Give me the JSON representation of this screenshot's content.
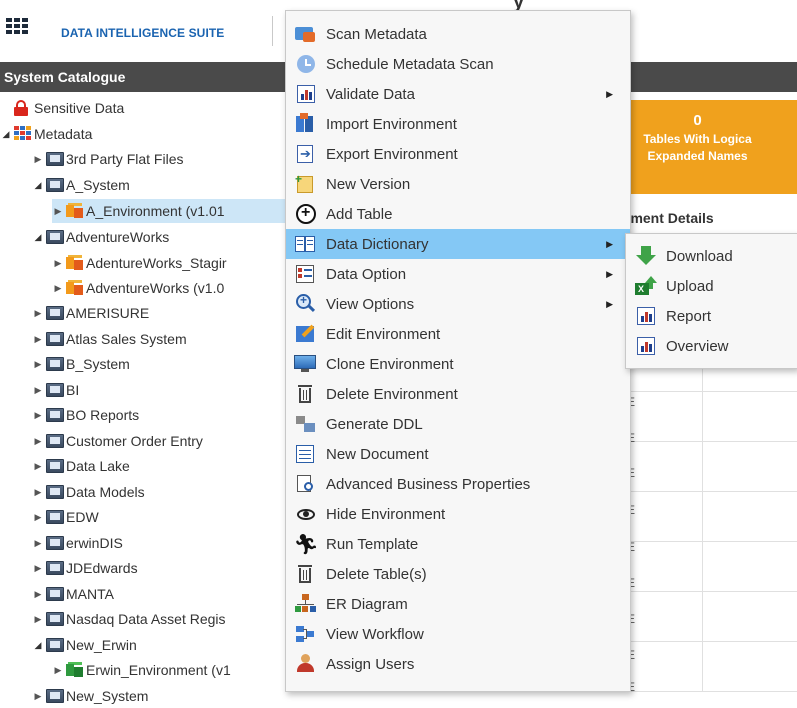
{
  "header": {
    "app_title": "DATA INTELLIGENCE SUITE",
    "top_fragment": "y"
  },
  "catalogue": {
    "title": "System Catalogue",
    "items": [
      {
        "label": "Sensitive Data",
        "icon": "lock-icon"
      },
      {
        "label": "Metadata",
        "icon": "metadata-grid-icon"
      },
      {
        "label": "3rd Party Flat Files",
        "icon": "system-icon"
      },
      {
        "label": "A_System",
        "icon": "system-icon"
      },
      {
        "label": "A_Environment (v1.01",
        "icon": "environment-icon"
      },
      {
        "label": "AdventureWorks",
        "icon": "system-icon"
      },
      {
        "label": "AdentureWorks_Stagir",
        "icon": "environment-icon"
      },
      {
        "label": "AdventureWorks (v1.0",
        "icon": "environment-icon"
      },
      {
        "label": "AMERISURE",
        "icon": "system-icon"
      },
      {
        "label": "Atlas Sales System",
        "icon": "system-icon"
      },
      {
        "label": "B_System",
        "icon": "system-icon"
      },
      {
        "label": "BI",
        "icon": "system-icon"
      },
      {
        "label": "BO Reports",
        "icon": "system-icon"
      },
      {
        "label": "Customer Order Entry",
        "icon": "system-icon"
      },
      {
        "label": "Data Lake",
        "icon": "system-icon"
      },
      {
        "label": "Data Models",
        "icon": "system-icon"
      },
      {
        "label": "EDW",
        "icon": "system-icon"
      },
      {
        "label": "erwinDIS",
        "icon": "system-icon"
      },
      {
        "label": "JDEdwards",
        "icon": "system-icon"
      },
      {
        "label": "MANTA",
        "icon": "system-icon"
      },
      {
        "label": "Nasdaq Data Asset Regis",
        "icon": "system-icon"
      },
      {
        "label": "New_Erwin",
        "icon": "system-icon"
      },
      {
        "label": "Erwin_Environment (v1",
        "icon": "erwin-environment-icon"
      },
      {
        "label": "New_System",
        "icon": "system-icon"
      }
    ]
  },
  "summary_card": {
    "count": "0",
    "label_line1": "Tables With Logica",
    "label_line2": "Expanded Names"
  },
  "env_details": {
    "heading": "ironment Details",
    "cell": "E"
  },
  "context_menu": {
    "items": [
      {
        "label": "Scan Metadata",
        "icon": "scan-metadata-icon"
      },
      {
        "label": "Schedule Metadata Scan",
        "icon": "clock-icon"
      },
      {
        "label": "Validate Data",
        "icon": "validate-chart-icon"
      },
      {
        "label": "Import Environment",
        "icon": "import-icon"
      },
      {
        "label": "Export Environment",
        "icon": "export-icon"
      },
      {
        "label": "New Version",
        "icon": "new-version-icon"
      },
      {
        "label": "Add Table",
        "icon": "add-circle-icon"
      },
      {
        "label": "Data Dictionary",
        "icon": "book-icon"
      },
      {
        "label": "Data Option",
        "icon": "data-option-icon"
      },
      {
        "label": "View Options",
        "icon": "zoom-icon"
      },
      {
        "label": "Edit Environment",
        "icon": "edit-icon"
      },
      {
        "label": "Clone Environment",
        "icon": "monitor-icon"
      },
      {
        "label": "Delete Environment",
        "icon": "trash-icon"
      },
      {
        "label": "Generate DDL",
        "icon": "ddl-icon"
      },
      {
        "label": "New Document",
        "icon": "document-icon"
      },
      {
        "label": "Advanced Business Properties",
        "icon": "properties-icon"
      },
      {
        "label": "Hide Environment",
        "icon": "eye-icon"
      },
      {
        "label": "Run Template",
        "icon": "runner-icon"
      },
      {
        "label": "Delete Table(s)",
        "icon": "trash-icon"
      },
      {
        "label": "ER Diagram",
        "icon": "er-diagram-icon"
      },
      {
        "label": "View Workflow",
        "icon": "workflow-icon"
      },
      {
        "label": "Assign Users",
        "icon": "user-icon"
      }
    ]
  },
  "submenu": {
    "items": [
      {
        "label": "Download",
        "icon": "download-arrow-icon"
      },
      {
        "label": "Upload",
        "icon": "excel-upload-icon"
      },
      {
        "label": "Report",
        "icon": "report-chart-icon"
      },
      {
        "label": "Overview",
        "icon": "overview-chart-icon"
      }
    ]
  },
  "colors": {
    "accent_blue": "#1a63b0",
    "menu_highlight": "#84c8f5",
    "card_orange": "#f0a11d",
    "header_dark": "#4a4a4a"
  }
}
